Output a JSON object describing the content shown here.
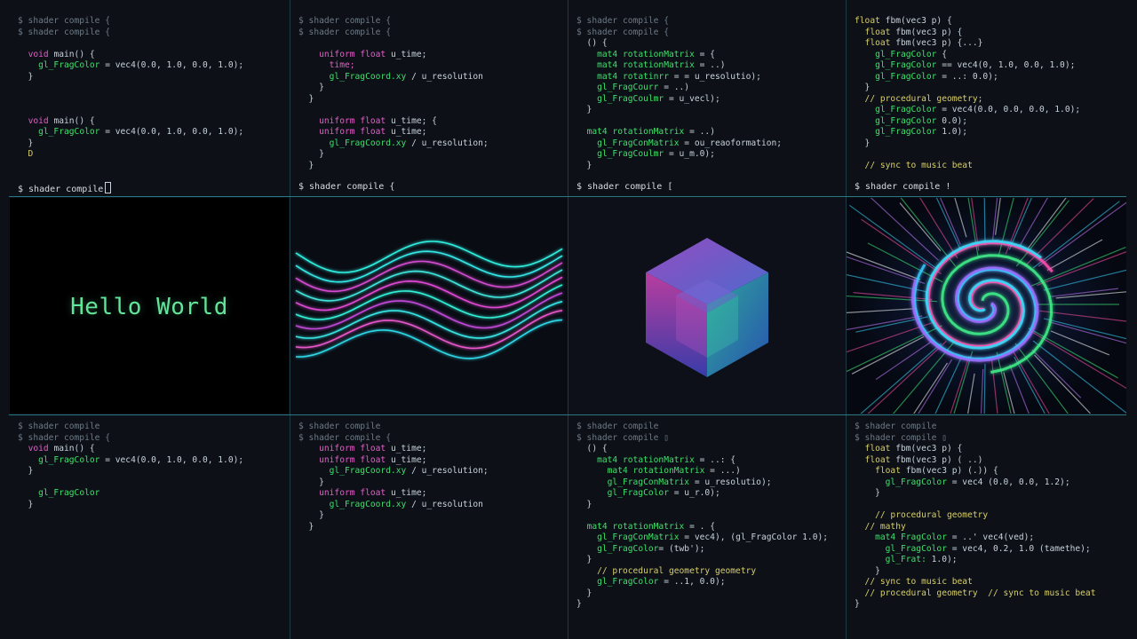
{
  "prompts": {
    "p1": "$ shader compile",
    "p2": "$ shader compile {",
    "p3": "$ shader compile [",
    "p4": "$ shader compile !"
  },
  "preview": {
    "hello_text": "Hello World"
  },
  "colors": {
    "accent_cyan": "#2b8a96",
    "keyword": "#e25fc8",
    "function": "#3fe06a",
    "hello_green": "#62e59a"
  },
  "panels": {
    "top1": [
      [
        [
          "t-p",
          "$ shader compile {"
        ]
      ],
      [
        [
          "t-p",
          "$ shader compile {"
        ]
      ],
      [],
      [
        [
          "t-x",
          "  "
        ],
        [
          "t-k",
          "void"
        ],
        [
          "t-x",
          " main() {"
        ]
      ],
      [
        [
          "t-x",
          "    "
        ],
        [
          "t-f",
          "gl_FragColor"
        ],
        [
          "t-x",
          " = vec4(0.0, 1.0, 0.0, 1.0);"
        ]
      ],
      [
        [
          "t-x",
          "  }"
        ]
      ],
      [],
      [],
      [],
      [
        [
          "t-x",
          "  "
        ],
        [
          "t-k",
          "void"
        ],
        [
          "t-x",
          " main() {"
        ]
      ],
      [
        [
          "t-x",
          "    "
        ],
        [
          "t-f",
          "gl_FragColor"
        ],
        [
          "t-x",
          " = vec4(0.0, 1.0, 0.0, 1.0);"
        ]
      ],
      [
        [
          "t-x",
          "  }"
        ]
      ],
      [
        [
          "t-c",
          "  D"
        ]
      ]
    ],
    "top2": [
      [
        [
          "t-p",
          "$ shader compile {"
        ]
      ],
      [
        [
          "t-p",
          "$ shader compile {"
        ]
      ],
      [],
      [
        [
          "t-x",
          "    "
        ],
        [
          "t-k",
          "uniform float"
        ],
        [
          "t-x",
          " u_time;"
        ]
      ],
      [
        [
          "t-x",
          "      "
        ],
        [
          "t-k",
          "time;"
        ]
      ],
      [
        [
          "t-x",
          "      "
        ],
        [
          "t-f",
          "gl_FragCoord.xy"
        ],
        [
          "t-x",
          " / u_resolution"
        ]
      ],
      [
        [
          "t-x",
          "    }"
        ]
      ],
      [
        [
          "t-x",
          "  }"
        ]
      ],
      [],
      [
        [
          "t-x",
          "    "
        ],
        [
          "t-k",
          "uniform float"
        ],
        [
          "t-x",
          " u_time; {"
        ]
      ],
      [
        [
          "t-x",
          "    "
        ],
        [
          "t-k",
          "uniform float"
        ],
        [
          "t-x",
          " u_time;"
        ]
      ],
      [
        [
          "t-x",
          "      "
        ],
        [
          "t-f",
          "gl_FragCoord.xy"
        ],
        [
          "t-x",
          " / u_resolution;"
        ]
      ],
      [
        [
          "t-x",
          "    }"
        ]
      ],
      [
        [
          "t-x",
          "  }"
        ]
      ]
    ],
    "top3": [
      [
        [
          "t-p",
          "$ shader compile {"
        ]
      ],
      [
        [
          "t-p",
          "$ shader compile {"
        ]
      ],
      [
        [
          "t-x",
          "  () {"
        ]
      ],
      [
        [
          "t-x",
          "    "
        ],
        [
          "t-f",
          "mat4 rotationMatrix"
        ],
        [
          "t-x",
          " = {"
        ]
      ],
      [
        [
          "t-x",
          "    "
        ],
        [
          "t-f",
          "mat4 rotationMatrix"
        ],
        [
          "t-x",
          " = ..)"
        ]
      ],
      [
        [
          "t-x",
          "    "
        ],
        [
          "t-f",
          "mat4 rotatinrr"
        ],
        [
          "t-x",
          " = = u_resolutio);"
        ]
      ],
      [
        [
          "t-x",
          "    "
        ],
        [
          "t-f",
          "gl_FragCourr"
        ],
        [
          "t-x",
          " = ..)"
        ]
      ],
      [
        [
          "t-x",
          "    "
        ],
        [
          "t-f",
          "gl_FragCoulmr"
        ],
        [
          "t-x",
          " = u_vecl);"
        ]
      ],
      [
        [
          "t-x",
          "  }"
        ]
      ],
      [],
      [
        [
          "t-x",
          "  "
        ],
        [
          "t-f",
          "mat4 rotationMatrix"
        ],
        [
          "t-x",
          " = ..)"
        ]
      ],
      [
        [
          "t-x",
          "    "
        ],
        [
          "t-f",
          "gl_FragConMatrix"
        ],
        [
          "t-x",
          " = ou_reaoformation;"
        ]
      ],
      [
        [
          "t-x",
          "    "
        ],
        [
          "t-f",
          "gl_FragCoulmr"
        ],
        [
          "t-x",
          " = u_m.0);"
        ]
      ],
      [
        [
          "t-x",
          "  }"
        ]
      ]
    ],
    "top4": [
      [
        [
          "t-c",
          "float"
        ],
        [
          "t-x",
          " fbm(vec3 p) {"
        ]
      ],
      [
        [
          "t-x",
          "  "
        ],
        [
          "t-c",
          "float"
        ],
        [
          "t-x",
          " fbm(vec3 p) {"
        ]
      ],
      [
        [
          "t-x",
          "  "
        ],
        [
          "t-c",
          "float"
        ],
        [
          "t-x",
          " fbm(vec3 p) {...}"
        ]
      ],
      [
        [
          "t-x",
          "    "
        ],
        [
          "t-f",
          "gl_FragColor"
        ],
        [
          "t-x",
          " {"
        ]
      ],
      [
        [
          "t-x",
          "    "
        ],
        [
          "t-f",
          "gl_FragColor"
        ],
        [
          "t-x",
          " == vec4(0, 1.0, 0.0, 1.0);"
        ]
      ],
      [
        [
          "t-x",
          "    "
        ],
        [
          "t-f",
          "gl_FragColor"
        ],
        [
          "t-x",
          " = ..: 0.0);"
        ]
      ],
      [
        [
          "t-x",
          "  }"
        ]
      ],
      [
        [
          "t-c",
          "  // procedural geometry;"
        ]
      ],
      [
        [
          "t-x",
          "    "
        ],
        [
          "t-f",
          "gl_FragColor"
        ],
        [
          "t-x",
          " = vec4(0.0, 0.0, 0.0, 1.0);"
        ]
      ],
      [
        [
          "t-x",
          "    "
        ],
        [
          "t-f",
          "gl_FragColor"
        ],
        [
          "t-x",
          " 0.0);"
        ]
      ],
      [
        [
          "t-x",
          "    "
        ],
        [
          "t-f",
          "gl_FragColor"
        ],
        [
          "t-x",
          " 1.0);"
        ]
      ],
      [
        [
          "t-x",
          "  }"
        ]
      ],
      [],
      [
        [
          "t-c",
          "  // sync to music beat"
        ]
      ]
    ],
    "bot1": [
      [
        [
          "t-p",
          "$ shader compile"
        ]
      ],
      [
        [
          "t-p",
          "$ shader compile {"
        ]
      ],
      [
        [
          "t-x",
          "  "
        ],
        [
          "t-k",
          "void"
        ],
        [
          "t-x",
          " main() {"
        ]
      ],
      [
        [
          "t-x",
          "    "
        ],
        [
          "t-f",
          "gl_FragColor"
        ],
        [
          "t-x",
          " = vec4(0.0, 1.0, 0.0, 1.0);"
        ]
      ],
      [
        [
          "t-x",
          "  }"
        ]
      ],
      [],
      [
        [
          "t-x",
          "    "
        ],
        [
          "t-f",
          "gl_FragColor"
        ]
      ],
      [
        [
          "t-x",
          "  }"
        ]
      ]
    ],
    "bot2": [
      [
        [
          "t-p",
          "$ shader compile"
        ]
      ],
      [
        [
          "t-p",
          "$ shader compile {"
        ]
      ],
      [
        [
          "t-x",
          "    "
        ],
        [
          "t-k",
          "uniform float"
        ],
        [
          "t-x",
          " u_time;"
        ]
      ],
      [
        [
          "t-x",
          "    "
        ],
        [
          "t-k",
          "uniform float"
        ],
        [
          "t-x",
          " u_time;"
        ]
      ],
      [
        [
          "t-x",
          "      "
        ],
        [
          "t-f",
          "gl_FragCoord.xy"
        ],
        [
          "t-x",
          " / u_resolution;"
        ]
      ],
      [
        [
          "t-x",
          "    }"
        ]
      ],
      [
        [
          "t-x",
          "    "
        ],
        [
          "t-k",
          "uniform float"
        ],
        [
          "t-x",
          " u_time;"
        ]
      ],
      [
        [
          "t-x",
          "      "
        ],
        [
          "t-f",
          "gl_FragCoord.xy"
        ],
        [
          "t-x",
          " / u_resolution"
        ]
      ],
      [
        [
          "t-x",
          "    }"
        ]
      ],
      [
        [
          "t-x",
          "  }"
        ]
      ]
    ],
    "bot3": [
      [
        [
          "t-p",
          "$ shader compile"
        ]
      ],
      [
        [
          "t-p",
          "$ shader compile ▯"
        ]
      ],
      [
        [
          "t-x",
          "  () {"
        ]
      ],
      [
        [
          "t-x",
          "    "
        ],
        [
          "t-f",
          "mat4 rotationMatrix"
        ],
        [
          "t-x",
          " = ..: {"
        ]
      ],
      [
        [
          "t-x",
          "      "
        ],
        [
          "t-f",
          "mat4 rotationMatrix"
        ],
        [
          "t-x",
          " = ...)"
        ]
      ],
      [
        [
          "t-x",
          "      "
        ],
        [
          "t-f",
          "gl_FragConMatrix"
        ],
        [
          "t-x",
          " = u_resolutio);"
        ]
      ],
      [
        [
          "t-x",
          "      "
        ],
        [
          "t-f",
          "gl_FragColor"
        ],
        [
          "t-x",
          " = u_r.0);"
        ]
      ],
      [
        [
          "t-x",
          "  }"
        ]
      ],
      [],
      [
        [
          "t-x",
          "  "
        ],
        [
          "t-f",
          "mat4 rotationMatrix"
        ],
        [
          "t-x",
          " = . {"
        ]
      ],
      [
        [
          "t-x",
          "    "
        ],
        [
          "t-f",
          "gl_FragConMatrix"
        ],
        [
          "t-x",
          " = vec4), (gl_FragColor 1.0);"
        ]
      ],
      [
        [
          "t-x",
          "    "
        ],
        [
          "t-f",
          "gl_FragColor"
        ],
        [
          "t-x",
          "= (twb');"
        ]
      ],
      [
        [
          "t-x",
          "  }"
        ]
      ],
      [
        [
          "t-c",
          "    // procedural geometry geometry"
        ]
      ],
      [
        [
          "t-x",
          "    "
        ],
        [
          "t-f",
          "gl_FragColor"
        ],
        [
          "t-x",
          " = ..1, 0.0);"
        ]
      ],
      [
        [
          "t-x",
          "  }"
        ]
      ],
      [
        [
          "t-x",
          "}"
        ]
      ]
    ],
    "bot4": [
      [
        [
          "t-p",
          "$ shader compile"
        ]
      ],
      [
        [
          "t-p",
          "$ shader compile ▯"
        ]
      ],
      [
        [
          "t-x",
          "  "
        ],
        [
          "t-c",
          "float"
        ],
        [
          "t-x",
          " fbm(vec3 p) {"
        ]
      ],
      [
        [
          "t-x",
          "  "
        ],
        [
          "t-c",
          "float"
        ],
        [
          "t-x",
          " fbm(vec3 p) ( ..)"
        ]
      ],
      [
        [
          "t-x",
          "    "
        ],
        [
          "t-c",
          "float"
        ],
        [
          "t-x",
          " fbm(vec3 p) (.)) {"
        ]
      ],
      [
        [
          "t-x",
          "      "
        ],
        [
          "t-f",
          "gl_FragColor"
        ],
        [
          "t-x",
          " = vec4 (0.0, 0.0, 1.2);"
        ]
      ],
      [
        [
          "t-x",
          "    }"
        ]
      ],
      [],
      [
        [
          "t-c",
          "    // procedural geometry"
        ]
      ],
      [
        [
          "t-c",
          "  // mathy"
        ]
      ],
      [
        [
          "t-x",
          "    "
        ],
        [
          "t-f",
          "mat4 FragColor"
        ],
        [
          "t-x",
          " = ..' vec4(ved);"
        ]
      ],
      [
        [
          "t-x",
          "      "
        ],
        [
          "t-f",
          "gl_FragColor"
        ],
        [
          "t-x",
          " = vec4, 0.2, 1.0 (tamethe);"
        ]
      ],
      [
        [
          "t-x",
          "      "
        ],
        [
          "t-f",
          "gl_Frat:"
        ],
        [
          "t-x",
          " 1.0);"
        ]
      ],
      [
        [
          "t-x",
          "    }"
        ]
      ],
      [
        [
          "t-c",
          "  // sync to music beat"
        ]
      ],
      [
        [
          "t-c",
          "  // procedural geometry  // sync to music beat"
        ]
      ],
      [
        [
          "t-x",
          "}"
        ]
      ]
    ]
  }
}
